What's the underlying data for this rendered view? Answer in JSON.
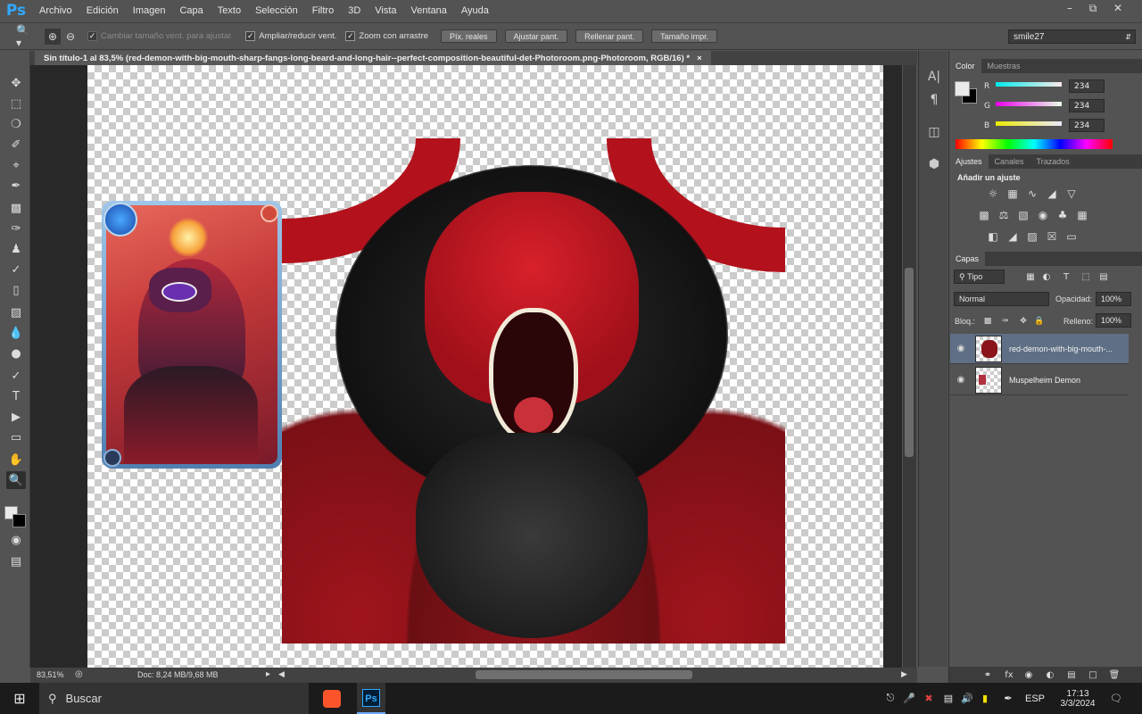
{
  "app": {
    "logo": "Ps"
  },
  "menu": [
    "Archivo",
    "Edición",
    "Imagen",
    "Capa",
    "Texto",
    "Selección",
    "Filtro",
    "3D",
    "Vista",
    "Ventana",
    "Ayuda"
  ],
  "options": {
    "check_resize": "Cambiar tamaño vent. para ajustar",
    "check_zoom_all": "Ampliar/reducir vent.",
    "check_scrubby": "Zoom con arrastre",
    "btn_actual": "Píx. reales",
    "btn_fit": "Ajustar pant.",
    "btn_fill": "Rellenar pant.",
    "btn_print": "Tamaño impr.",
    "workspace": "smile27"
  },
  "document": {
    "tab_title": "Sin título-1 al 83,5% (red-demon-with-big-mouth-sharp-fangs-long-beard-and-long-hair--perfect-composition-beautiful-det-Photoroom.png-Photoroom, RGB/16) *",
    "close": "×"
  },
  "status": {
    "zoom": "83,51%",
    "doc": "Doc: 8,24 MB/9,68 MB"
  },
  "color_panel": {
    "tabs": [
      "Color",
      "Muestras"
    ],
    "r_label": "R",
    "g_label": "G",
    "b_label": "B",
    "r": "234",
    "g": "234",
    "b": "234"
  },
  "adjust_panel": {
    "tabs": [
      "Ajustes",
      "Canales",
      "Trazados"
    ],
    "heading": "Añadir un ajuste"
  },
  "layers_panel": {
    "tab": "Capas",
    "filter": "Tipo",
    "blend": "Normal",
    "opacity_label": "Opacidad:",
    "opacity": "100%",
    "lock_label": "Bloq.:",
    "fill_label": "Relleno:",
    "fill": "100%",
    "layers": [
      {
        "name": "red-demon-with-big-mouth-..."
      },
      {
        "name": "Muspelheim Demon"
      }
    ]
  },
  "taskbar": {
    "search": "Buscar",
    "lang": "ESP",
    "time": "17:13",
    "date": "3/3/2024"
  },
  "colors": {
    "accent": "#31a8ff",
    "selected_layer": "#5f6f85"
  }
}
